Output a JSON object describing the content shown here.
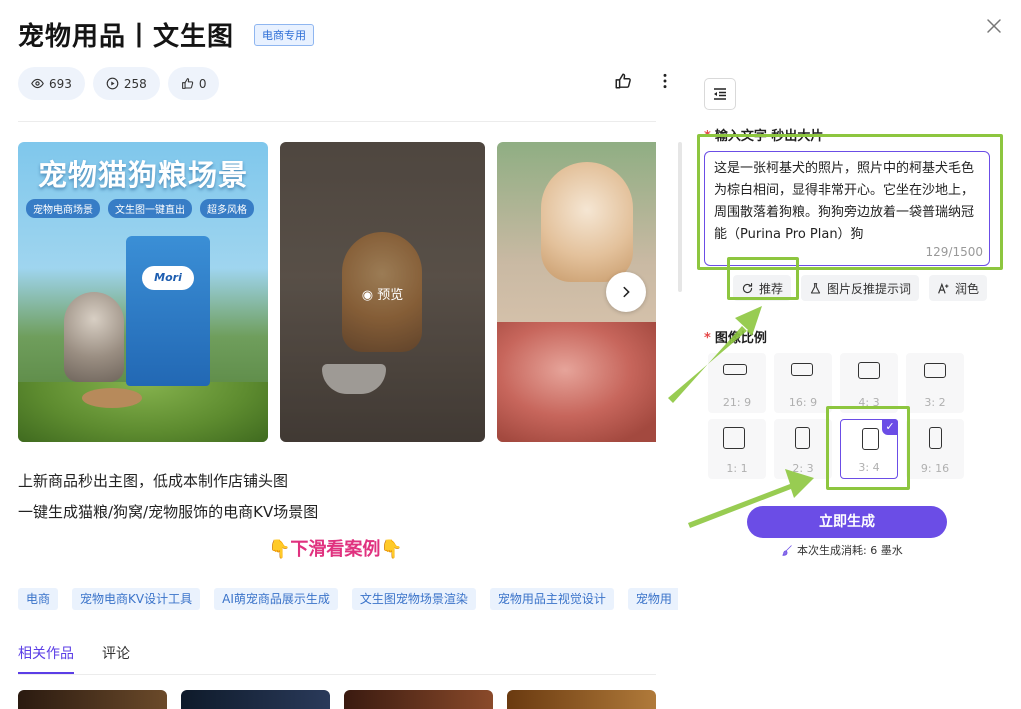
{
  "header": {
    "title": "宠物用品丨文生图",
    "badge": "电商专用"
  },
  "stats": {
    "views": "693",
    "plays": "258",
    "likes": "0"
  },
  "gallery": {
    "card1": {
      "title": "宠物猫狗粮场景",
      "tags": [
        "宠物电商场景",
        "文生图一键直出",
        "超多风格"
      ],
      "brand": "Mori"
    },
    "card2": {
      "preview_label": "预览"
    }
  },
  "description": {
    "line1": "上新商品秒出主图，低成本制作店铺头图",
    "line2": "一键生成猫粮/狗窝/宠物服饰的电商KV场景图",
    "scroll_hint": "👇下滑看案例👇"
  },
  "chips": [
    "电商",
    "宠物电商KV设计工具",
    "AI萌宠商品展示生成",
    "文生图宠物场景渲染",
    "宠物用品主视觉设计",
    "宠物用"
  ],
  "tabs": [
    {
      "label": "相关作品"
    },
    {
      "label": "评论"
    }
  ],
  "panel": {
    "prompt_label": "输入文字 秒出大片",
    "prompt_text": "这是一张柯基犬的照片，照片中的柯基犬毛色为棕白相间，显得非常开心。它坐在沙地上，周围散落着狗粮。狗狗旁边放着一袋普瑞纳冠能（Purina Pro Plan）狗",
    "prompt_count": "129/1500",
    "buttons": {
      "recommend": "推荐",
      "reverse": "图片反推提示词",
      "polish": "润色"
    },
    "ratio_label": "图像比例",
    "ratios": [
      "21: 9",
      "16: 9",
      "4: 3",
      "3: 2",
      "1: 1",
      "2: 3",
      "3: 4",
      "9: 16"
    ],
    "selected_ratio": "3: 4",
    "generate_label": "立即生成",
    "cost_text": "本次生成消耗: 6 墨水"
  },
  "colors": {
    "accent": "#6b4de6",
    "annotation": "#8dc63f",
    "hint": "#e0327f"
  }
}
